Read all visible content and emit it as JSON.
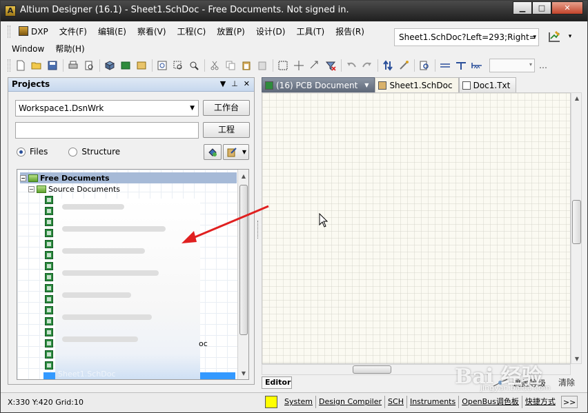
{
  "window": {
    "title": "Altium Designer (16.1) - Sheet1.SchDoc - Free Documents. Not signed in.",
    "app_icon_letter": "A",
    "minimize": "▁",
    "maximize": "□",
    "close": "✕"
  },
  "menu": {
    "row1": [
      "DXP",
      "文件(F)",
      "编辑(E)",
      "察看(V)",
      "工程(C)",
      "放置(P)",
      "设计(D)",
      "工具(T)",
      "报告(R)"
    ],
    "row2": [
      "Window",
      "帮助(H)"
    ]
  },
  "location_combo": {
    "value": "Sheet1.SchDoc?Left=293;Right=",
    "arrow": "▾"
  },
  "toolbar": {
    "more": "…"
  },
  "projects_panel": {
    "title": "Projects",
    "workspace_combo": "Workspace1.DsnWrk",
    "workspace_button": "工作台",
    "project_combo": "",
    "project_button": "工程",
    "view_files": "Files",
    "view_structure": "Structure",
    "tree": {
      "root": "Free Documents",
      "child": "Source Documents",
      "blurred_fragment": "oc",
      "blurred_bottom": "Sheet1.SchDoc"
    }
  },
  "doc_tabs": [
    {
      "label": "(16) PCB Document",
      "type": "pcb"
    },
    {
      "label": "Sheet1.SchDoc",
      "type": "sch"
    },
    {
      "label": "Doc1.Txt",
      "type": "txt"
    }
  ],
  "editor_tab": "Editor",
  "mask_level": "遮盖等级",
  "clear": "清除",
  "statusbar": {
    "coords": "X:330 Y:420   Grid:10",
    "buttons": [
      "System",
      "Design Compiler",
      "SCH",
      "Instruments",
      "OpenBus调色板",
      "快捷方式"
    ],
    "more": ">>"
  },
  "watermark": {
    "brand": "Bai 经验",
    "url": "jingyan.baidu.com"
  },
  "colors": {
    "titlebar": "#1f1f1f",
    "panel_header": "#c7d8ee",
    "selection": "#3399ff",
    "arrow_annotation": "#e02020",
    "status_swatch": "#ffff00"
  }
}
